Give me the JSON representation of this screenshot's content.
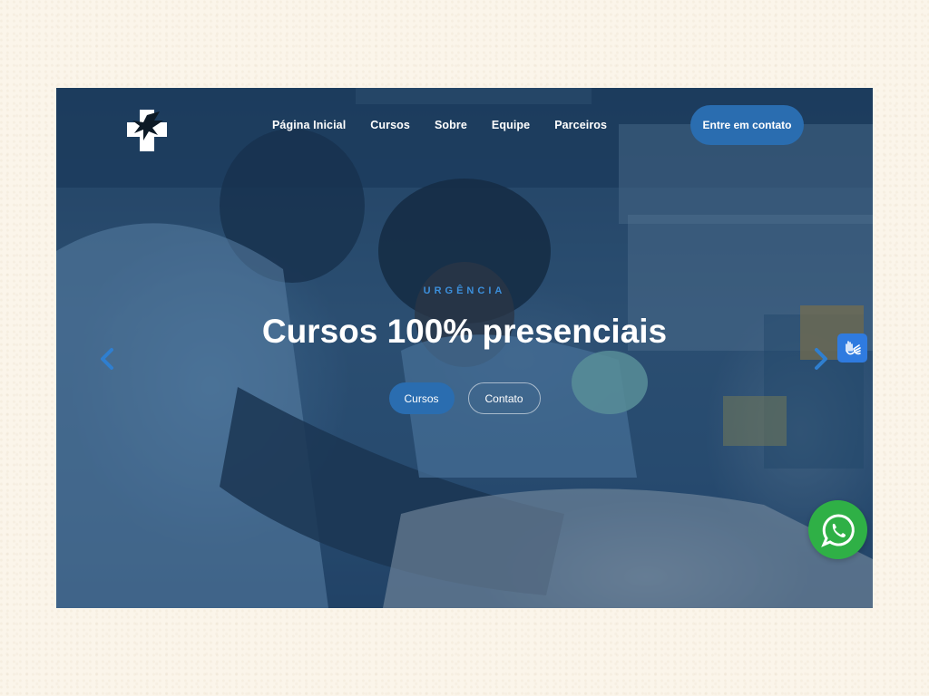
{
  "brand": {
    "logo_icon": "eagle-cross-logo-icon"
  },
  "nav": {
    "items": [
      {
        "label": "Página Inicial"
      },
      {
        "label": "Cursos"
      },
      {
        "label": "Sobre"
      },
      {
        "label": "Equipe"
      },
      {
        "label": "Parceiros"
      }
    ],
    "cta_label": "Entre em contato"
  },
  "hero": {
    "eyebrow": "URGÊNCIA",
    "headline": "Cursos 100% presenciais",
    "primary_button": "Cursos",
    "secondary_button": "Contato",
    "prev_icon": "chevron-left-icon",
    "next_icon": "chevron-right-icon"
  },
  "widgets": {
    "accessibility_icon": "sign-language-hands-icon",
    "whatsapp_icon": "whatsapp-icon"
  },
  "colors": {
    "accent": "#2a6db0",
    "eyebrow": "#3c8fdb",
    "page_bg": "#fbf5ea",
    "whatsapp": "#2fb046",
    "accessibility": "#2f7be0"
  }
}
